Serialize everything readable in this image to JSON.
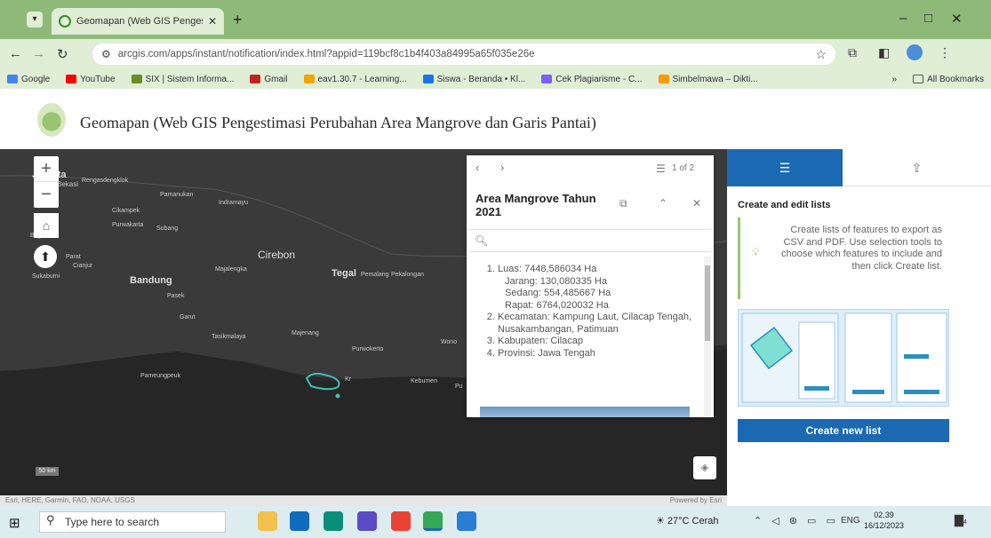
{
  "browser": {
    "tab_title": "Geomapan (Web GIS Pengesti...",
    "url": "arcgis.com/apps/instant/notification/index.html?appid=119bcf8c1b4f403a84995a65f035e26e",
    "bookmarks": [
      "Google",
      "YouTube",
      "SIX | Sistem Informa...",
      "Gmail",
      "eav1.30.7 - Learning...",
      "Siswa - Beranda • Kl...",
      "Cek Plagiarisme - C...",
      "Simbelmawa – Dikti..."
    ],
    "bookmark_colors": [
      "#4285f4",
      "#ff0000",
      "#6b8e23",
      "#c5221f",
      "#f0a500",
      "#1a73e8",
      "#7b61ff",
      "#ff9800"
    ],
    "all_bookmarks": "All Bookmarks",
    "overflow": "»"
  },
  "app": {
    "title": "Geomapan (Web GIS Pengestimasi Perubahan Area Mangrove dan Garis Pantai)"
  },
  "map": {
    "labels": [
      {
        "text": "Jakarta",
        "size": 11
      },
      {
        "text": "Bekasi",
        "size": 8
      },
      {
        "text": "Rengasdengklok",
        "size": 7
      },
      {
        "text": "Pamanukan",
        "size": 7
      },
      {
        "text": "Indramayu",
        "size": 7
      },
      {
        "text": "Cikampek",
        "size": 7
      },
      {
        "text": "Purwakarta",
        "size": 7
      },
      {
        "text": "Subang",
        "size": 7
      },
      {
        "text": "Bogor",
        "size": 7
      },
      {
        "text": "Parat",
        "size": 7
      },
      {
        "text": "Cianjur",
        "size": 7
      },
      {
        "text": "Sukabumi",
        "size": 7
      },
      {
        "text": "Cirebon",
        "size": 12
      },
      {
        "text": "Bandung",
        "size": 11
      },
      {
        "text": "Tegal",
        "size": 11
      },
      {
        "text": "Pemalang",
        "size": 7
      },
      {
        "text": "Pekalongan",
        "size": 7
      },
      {
        "text": "Majalengka",
        "size": 7
      },
      {
        "text": "Pasek",
        "size": 7
      },
      {
        "text": "Garut",
        "size": 7
      },
      {
        "text": "Tasikmalaya",
        "size": 7
      },
      {
        "text": "Majenang",
        "size": 7
      },
      {
        "text": "Purwokerto",
        "size": 7
      },
      {
        "text": "Wono",
        "size": 7
      },
      {
        "text": "Pameungpeuk",
        "size": 7
      },
      {
        "text": "Kebumen",
        "size": 7
      },
      {
        "text": "Pu",
        "size": 7
      },
      {
        "text": "Kr",
        "size": 7
      }
    ],
    "scale": "50 km",
    "attribution": "Esri, HERE, Garmin, FAO, NOAA, USGS",
    "powered_by": "Powered by Esri"
  },
  "popup": {
    "nav": "‹ ›",
    "count": "1 of 2",
    "title": "Area Mangrove Tahun 2021",
    "items": [
      {
        "main": "Luas: 7448,586034 Ha",
        "subs": [
          "Jarang: 130,080335 Ha",
          "Sedang: 554,485667 Ha",
          "Rapat: 6764,020032 Ha"
        ]
      },
      {
        "main": "Kecamatan: Kampung Laut, Cilacap Tengah, Nusakambangan, Patimuan",
        "subs": []
      },
      {
        "main": "Kabupaten: Cilacap",
        "subs": []
      },
      {
        "main": "Provinsi: Jawa Tengah",
        "subs": []
      }
    ]
  },
  "panel": {
    "heading": "Create and edit lists",
    "info": "Create lists of features to export as CSV and PDF. Use selection tools to choose which features to include and then click Create list.",
    "button": "Create new list"
  },
  "taskbar": {
    "search_placeholder": "Type here to search",
    "weather": "27°C Cerah",
    "lang": "ENG",
    "time": "02.39",
    "date": "16/12/2023",
    "notif_count": "4"
  },
  "colors": {
    "accent": "#1b69b3",
    "chrome_green": "#8fb979",
    "mangrove": "#3fbfb4"
  }
}
